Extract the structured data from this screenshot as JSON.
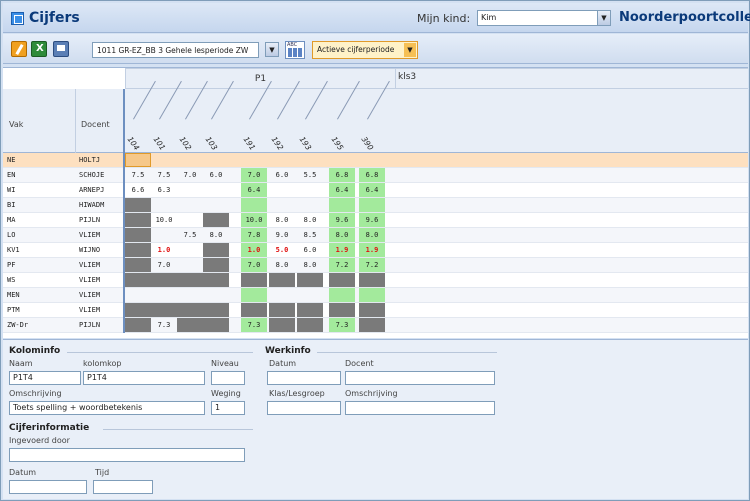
{
  "window": {
    "title": "Cijfers",
    "child_label": "Mijn kind:",
    "child_value": "Kim",
    "school": "Noorderpoortcollege"
  },
  "toolbar": {
    "group_select": "1011 GR-EZ_BB 3 Gehele lesperiode ZW",
    "abc_label": "ABC",
    "period_select": "Actieve cijferperiode"
  },
  "grid": {
    "period_label": "P1",
    "kls_label": "kls3",
    "header_vak": "Vak",
    "header_docent": "Docent",
    "columns": [
      "104",
      "101",
      "102",
      "103",
      "191",
      "192",
      "193",
      "195",
      "390"
    ],
    "rows": [
      {
        "vak": "NE",
        "docent": "HOLTJ",
        "cells": [
          "",
          "",
          "",
          "",
          "",
          "",
          "",
          "",
          ""
        ]
      },
      {
        "vak": "EN",
        "docent": "SCHOJE",
        "cells": [
          "7.5",
          "7.5",
          "7.0",
          "6.0",
          "7.0",
          "6.0",
          "5.5",
          "6.8",
          "6.8"
        ]
      },
      {
        "vak": "WI",
        "docent": "ARNEPJ",
        "cells": [
          "6.6",
          "6.3",
          "",
          "",
          "6.4",
          "",
          "",
          "6.4",
          "6.4"
        ]
      },
      {
        "vak": "BI",
        "docent": "HIWADM",
        "cells": [
          "",
          "",
          "",
          "",
          "",
          "",
          "",
          "",
          ""
        ]
      },
      {
        "vak": "MA",
        "docent": "PIJLN",
        "cells": [
          "",
          "10.0",
          "",
          "",
          "10.0",
          "8.0",
          "8.0",
          "9.6",
          "9.6"
        ]
      },
      {
        "vak": "LO",
        "docent": "VLIEM",
        "cells": [
          "",
          "",
          "7.5",
          "8.0",
          "7.8",
          "9.0",
          "8.5",
          "8.0",
          "8.0"
        ]
      },
      {
        "vak": "KV1",
        "docent": "WIJNO",
        "cells": [
          "",
          "1.0",
          "",
          "",
          "1.0",
          "5.0",
          "6.0",
          "1.9",
          "1.9"
        ]
      },
      {
        "vak": "PF",
        "docent": "VLIEM",
        "cells": [
          "",
          "7.0",
          "",
          "",
          "7.0",
          "8.0",
          "8.0",
          "7.2",
          "7.2"
        ]
      },
      {
        "vak": "WS",
        "docent": "VLIEM",
        "cells": [
          "",
          "",
          "",
          "",
          "",
          "",
          "",
          "",
          ""
        ]
      },
      {
        "vak": "MEN",
        "docent": "VLIEM",
        "cells": [
          "",
          "",
          "",
          "",
          "",
          "",
          "",
          "",
          ""
        ]
      },
      {
        "vak": "PTM",
        "docent": "VLIEM",
        "cells": [
          "",
          "",
          "",
          "",
          "",
          "",
          "",
          "",
          ""
        ]
      },
      {
        "vak": "ZW-Dr",
        "docent": "PIJLN",
        "cells": [
          "",
          "7.3",
          "",
          "",
          "7.3",
          "",
          "",
          "7.3",
          ""
        ]
      }
    ]
  },
  "kolominfo": {
    "section": "Kolominfo",
    "naam_label": "Naam",
    "naam_value": "P1T4",
    "kolomkop_label": "kolomkop",
    "kolomkop_value": "P1T4",
    "niveau_label": "Niveau",
    "niveau_value": "",
    "omschrijving_label": "Omschrijving",
    "omschrijving_value": "Toets spelling + woordbetekenis",
    "weging_label": "Weging",
    "weging_value": "1"
  },
  "werkinfo": {
    "section": "Werkinfo",
    "datum_label": "Datum",
    "datum_value": "",
    "docent_label": "Docent",
    "docent_value": "",
    "klas_label": "Klas/Lesgroep",
    "klas_value": "",
    "omschrijving_label": "Omschrijving",
    "omschrijving_value": ""
  },
  "cijferinfo": {
    "section": "Cijferinformatie",
    "ingevoerd_label": "Ingevoerd door",
    "ingevoerd_value": "",
    "datum_label": "Datum",
    "datum_value": "",
    "tijd_label": "Tijd",
    "tijd_value": ""
  }
}
